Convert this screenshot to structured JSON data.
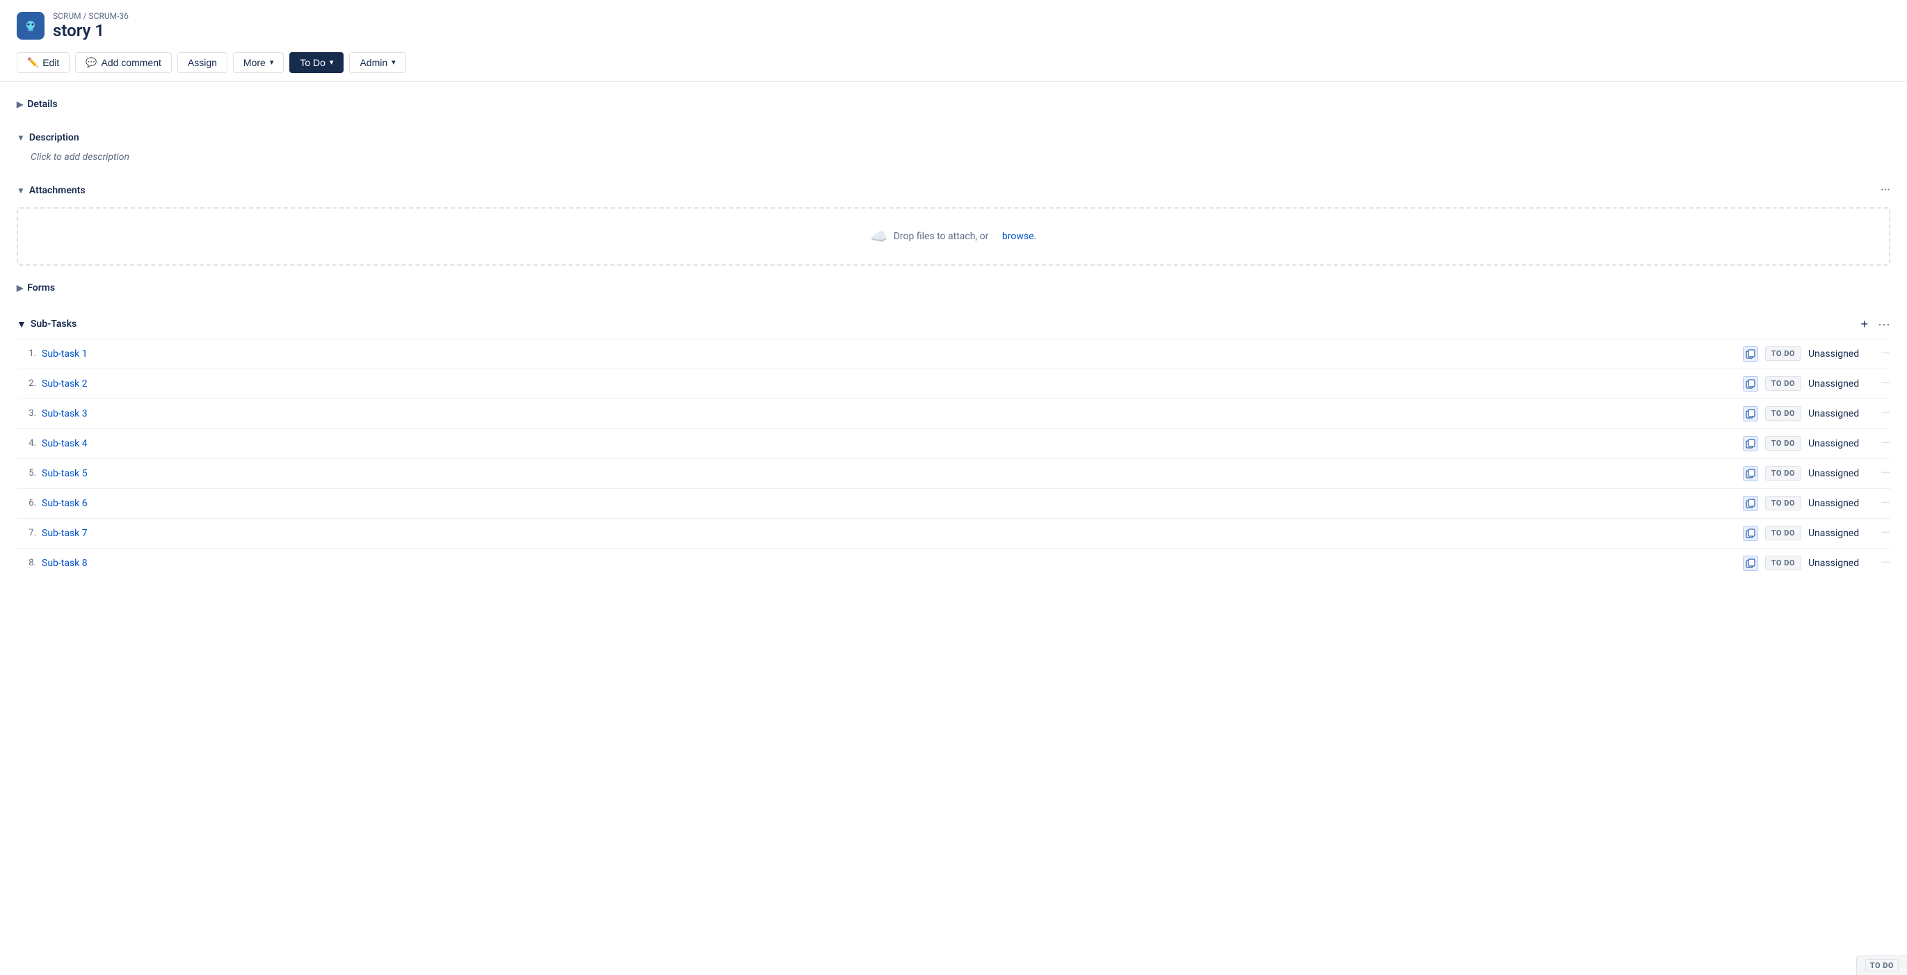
{
  "breadcrumb": {
    "project": "SCRUM",
    "separator": "/",
    "issue": "SCRUM-36"
  },
  "page": {
    "title": "story 1"
  },
  "toolbar": {
    "edit_label": "Edit",
    "add_comment_label": "Add comment",
    "assign_label": "Assign",
    "more_label": "More",
    "todo_label": "To Do",
    "admin_label": "Admin"
  },
  "sections": {
    "details": {
      "label": "Details",
      "expanded": false
    },
    "description": {
      "label": "Description",
      "expanded": true,
      "placeholder": "Click to add description"
    },
    "attachments": {
      "label": "Attachments",
      "expanded": true,
      "drop_text": "Drop files to attach, or",
      "browse_text": "browse.",
      "more_icon": "···"
    },
    "forms": {
      "label": "Forms",
      "expanded": false
    },
    "subtasks": {
      "label": "Sub-Tasks",
      "expanded": true,
      "add_icon": "+",
      "more_icon": "···",
      "items": [
        {
          "num": "1.",
          "label": "Sub-task 1",
          "status": "TO DO",
          "assignee": "Unassigned"
        },
        {
          "num": "2.",
          "label": "Sub-task 2",
          "status": "TO DO",
          "assignee": "Unassigned"
        },
        {
          "num": "3.",
          "label": "Sub-task 3",
          "status": "TO DO",
          "assignee": "Unassigned"
        },
        {
          "num": "4.",
          "label": "Sub-task 4",
          "status": "TO DO",
          "assignee": "Unassigned"
        },
        {
          "num": "5.",
          "label": "Sub-task 5",
          "status": "TO DO",
          "assignee": "Unassigned"
        },
        {
          "num": "6.",
          "label": "Sub-task 6",
          "status": "TO DO",
          "assignee": "Unassigned"
        },
        {
          "num": "7.",
          "label": "Sub-task 7",
          "status": "TO DO",
          "assignee": "Unassigned"
        },
        {
          "num": "8.",
          "label": "Sub-task 8",
          "status": "TO DO",
          "assignee": "Unassigned"
        }
      ]
    }
  },
  "status_bar": {
    "todo_label": "To DO"
  }
}
